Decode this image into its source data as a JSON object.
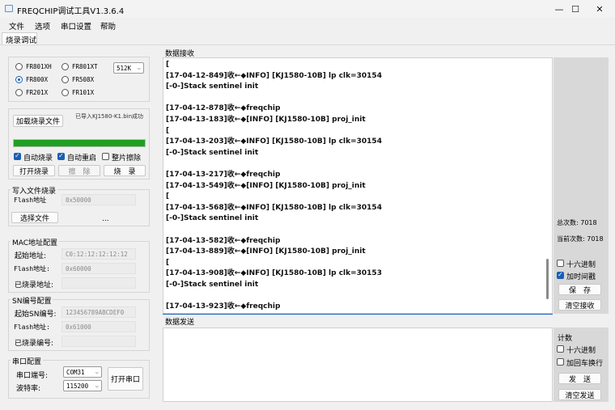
{
  "window": {
    "title": "FREQCHIP调试工具V1.3.6.4",
    "minimize_glyph": "—",
    "maximize_glyph": "☐",
    "close_glyph": "✕"
  },
  "menu": [
    "文件",
    "选项",
    "串口设置",
    "帮助"
  ],
  "tabs": [
    {
      "label": "烧录调试",
      "active": true
    }
  ],
  "chips": {
    "options": [
      "FR801XH",
      "FR801XT",
      "FR800X",
      "FR508X",
      "FR201X",
      "FR101X"
    ],
    "selected": "FR800X",
    "size_value": "512K"
  },
  "burn": {
    "load_button": "加载烧录文件",
    "file_status": "已导入KJ1580-K1.bin成功",
    "progress_percent": 100,
    "progress_color": "#1fa020",
    "auto_burn_label": "自动烧录",
    "auto_burn": true,
    "auto_restart_label": "自动重启",
    "auto_restart": true,
    "full_erase_label": "整片擦除",
    "full_erase": false,
    "open_burn_button": "打开烧录",
    "erase_button": "擦　除",
    "burn_button": "烧　录"
  },
  "write_file": {
    "title": "写入文件烧录",
    "flash_label": "Flash地址",
    "flash_value": "0x50000",
    "select_file_button": "选择文件",
    "ellipsis": "..."
  },
  "mac": {
    "title": "MAC地址配置",
    "start_label": "起始地址:",
    "start_value": "C0:12:12:12:12:12",
    "flash_label": "Flash地址:",
    "flash_value": "0x60000",
    "burned_label": "已烧录地址:",
    "burned_value": ""
  },
  "sn": {
    "title": "SN编号配置",
    "start_label": "起始SN编号:",
    "start_value": "123456789ABCDEF0",
    "flash_label": "Flash地址:",
    "flash_value": "0x61000",
    "burned_label": "已烧录编号:",
    "burned_value": ""
  },
  "serial": {
    "title": "串口配置",
    "port_label": "串口端号:",
    "port_value": "COM31",
    "baud_label": "波特率:",
    "baud_value": "115200",
    "open_button": "打开串口"
  },
  "receive": {
    "title": "数据接收",
    "lines": [
      "[",
      "[17-04-12-849]收←◆INFO] [KJ1580-10B] lp clk=30154",
      "[-0-]Stack sentinel init",
      "",
      "[17-04-12-878]收←◆freqchip",
      "[17-04-13-183]收←◆[INFO] [KJ1580-10B] proj_init",
      "[",
      "[17-04-13-203]收←◆INFO] [KJ1580-10B] lp clk=30154",
      "[-0-]Stack sentinel init",
      "",
      "[17-04-13-217]收←◆freqchip",
      "[17-04-13-549]收←◆[INFO] [KJ1580-10B] proj_init",
      "[",
      "[17-04-13-568]收←◆INFO] [KJ1580-10B] lp clk=30154",
      "[-0-]Stack sentinel init",
      "",
      "[17-04-13-582]收←◆freqchip",
      "[17-04-13-889]收←◆[INFO] [KJ1580-10B] proj_init",
      "[",
      "[17-04-13-908]收←◆INFO] [KJ1580-10B] lp clk=30153",
      "[-0-]Stack sentinel init",
      "",
      "[17-04-13-923]收←◆freqchip"
    ],
    "total_label": "总次数: 7018",
    "current_label": "当前次数: 7018",
    "hex_label": "十六进制",
    "hex": false,
    "timestamp_label": "加时间戳",
    "timestamp": true,
    "save_button": "保　存",
    "clear_button": "清空接收"
  },
  "send": {
    "title": "数据发送",
    "count_label": "计数",
    "hex_label": "十六进制",
    "hex": false,
    "crlf_label": "加回车换行",
    "crlf": false,
    "send_button": "发　送",
    "clear_button": "清空发送"
  }
}
